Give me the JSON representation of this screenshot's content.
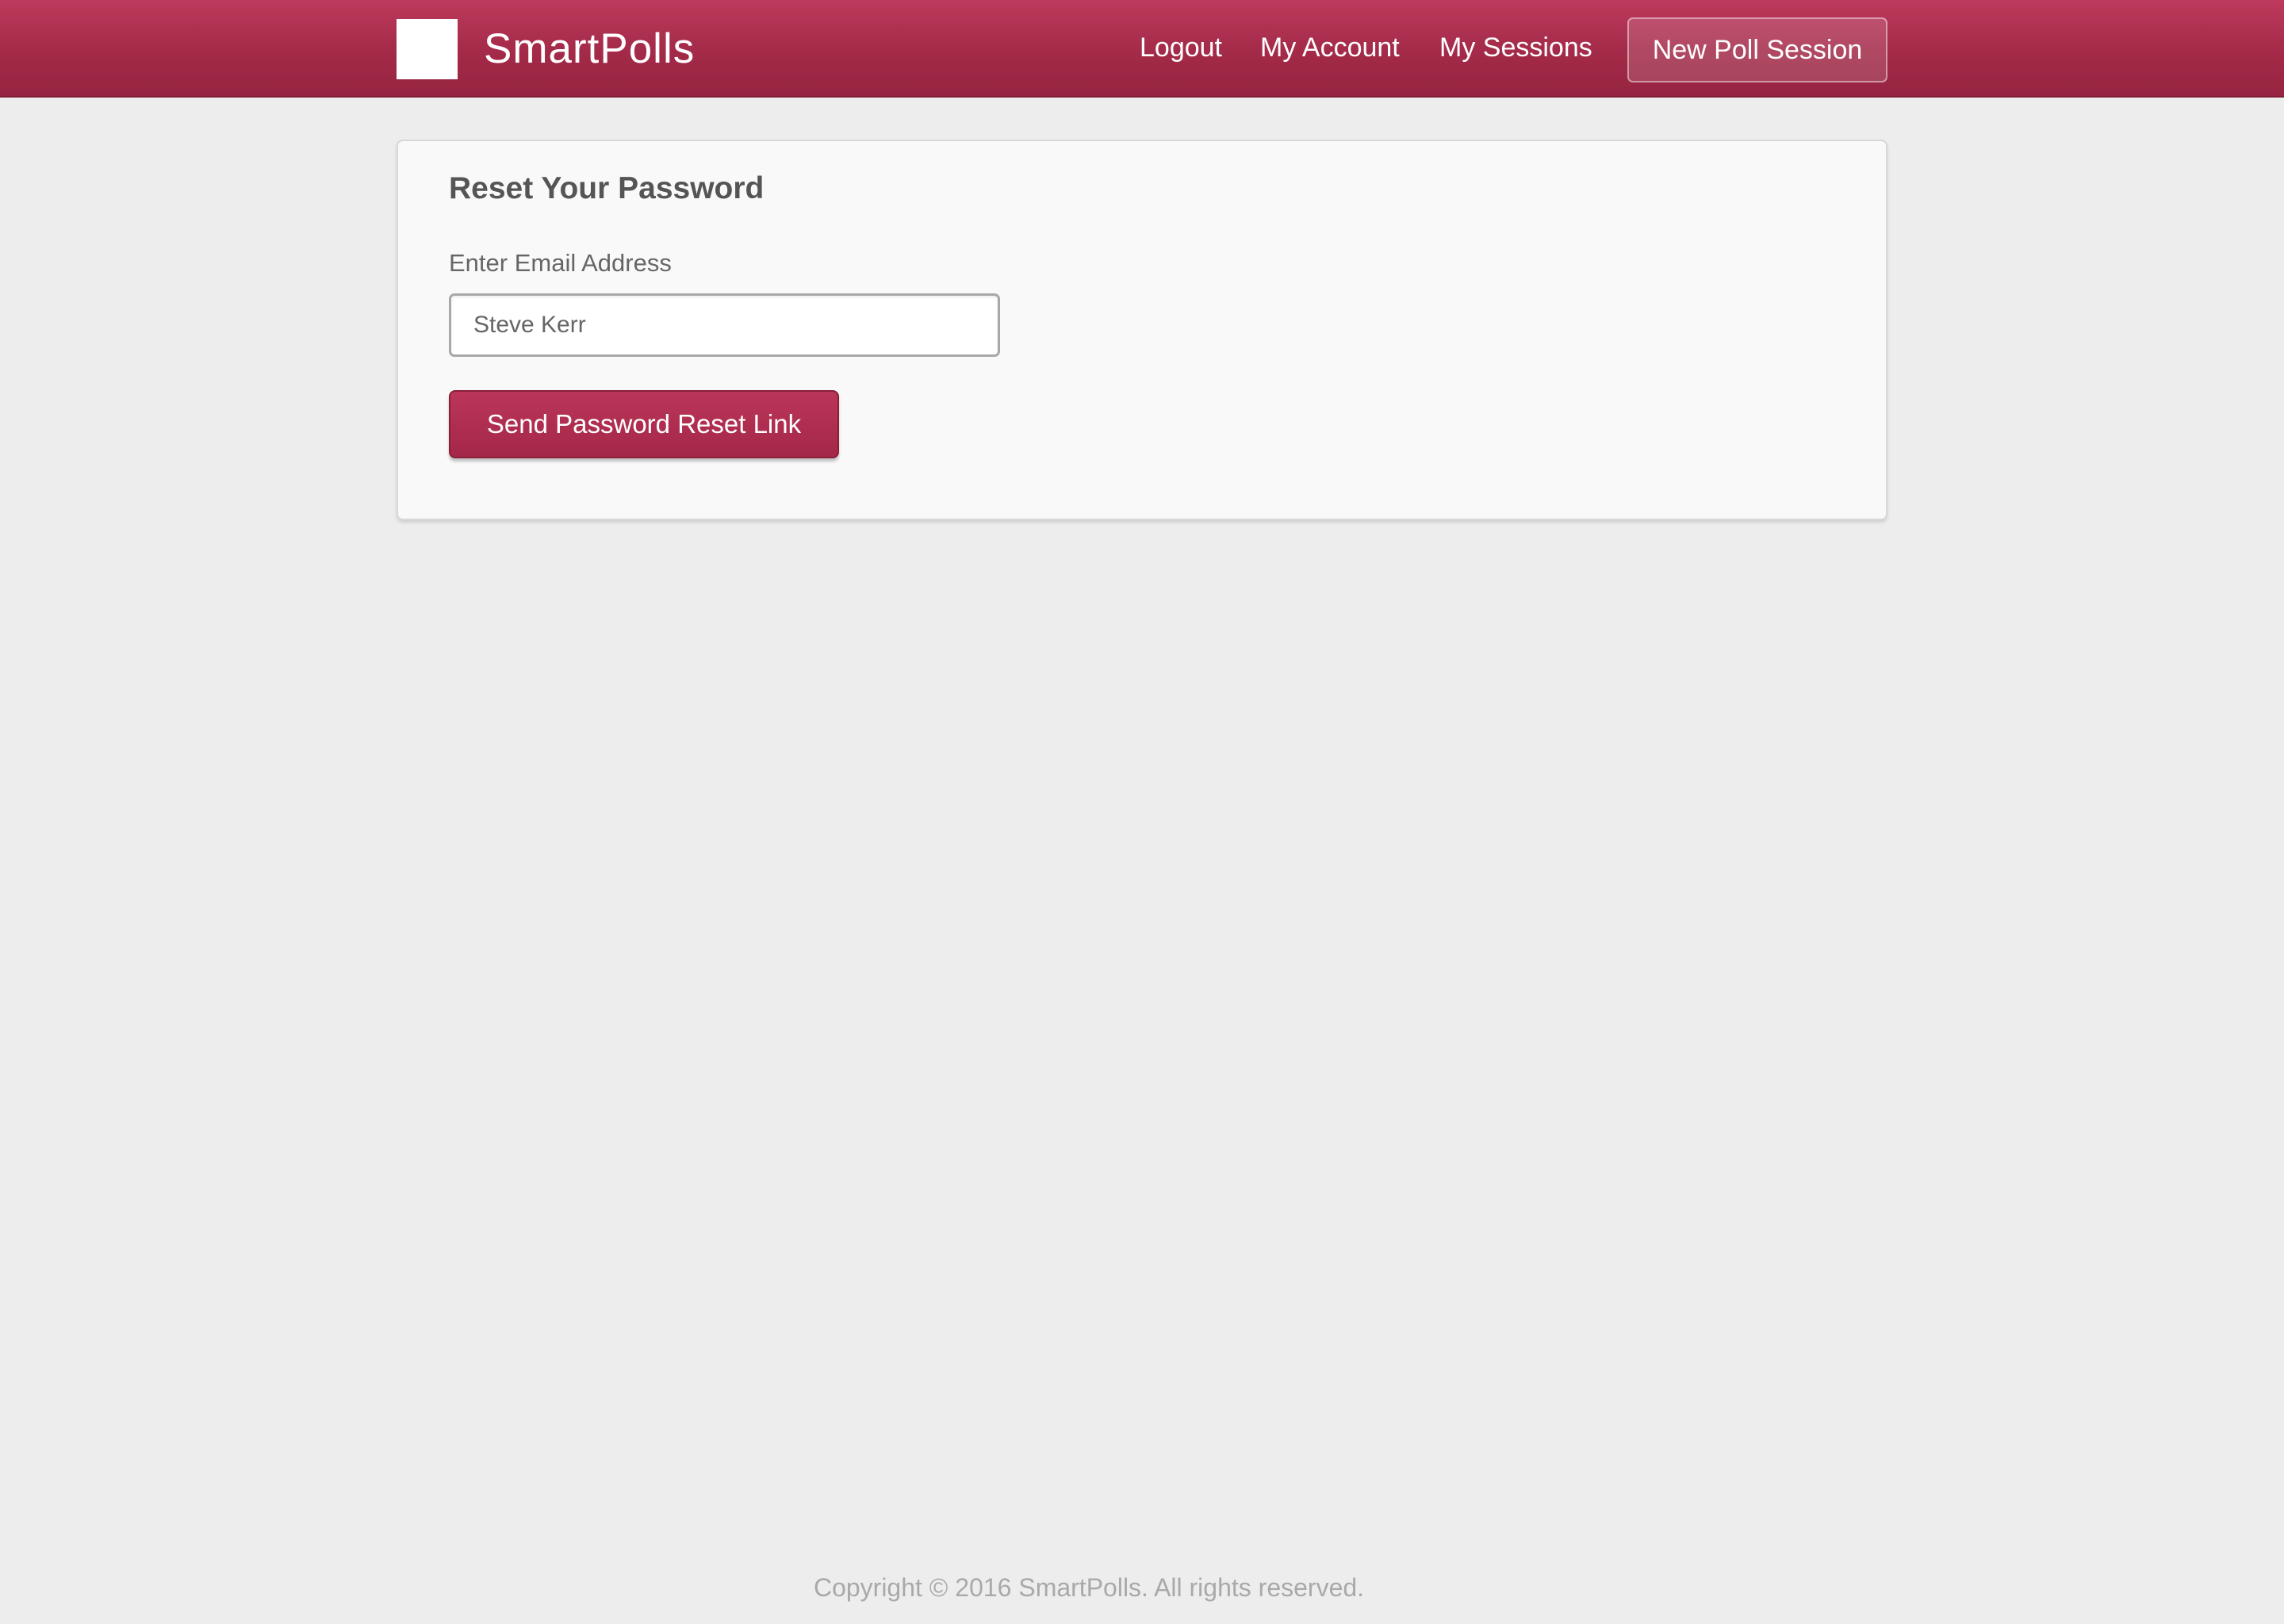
{
  "header": {
    "brand_name": "SmartPolls",
    "nav": {
      "logout": "Logout",
      "my_account": "My Account",
      "my_sessions": "My Sessions"
    },
    "new_poll_button": "New Poll Session"
  },
  "reset_form": {
    "title": "Reset Your Password",
    "email_label": "Enter Email Address",
    "email_value": "Steve Kerr",
    "submit_label": "Send Password Reset Link"
  },
  "footer": {
    "copyright": "Copyright © 2016 SmartPolls. All rights reserved."
  },
  "colors": {
    "brand": "#a32a48",
    "page_background": "#ededed",
    "card_background": "#f9f9f9"
  }
}
